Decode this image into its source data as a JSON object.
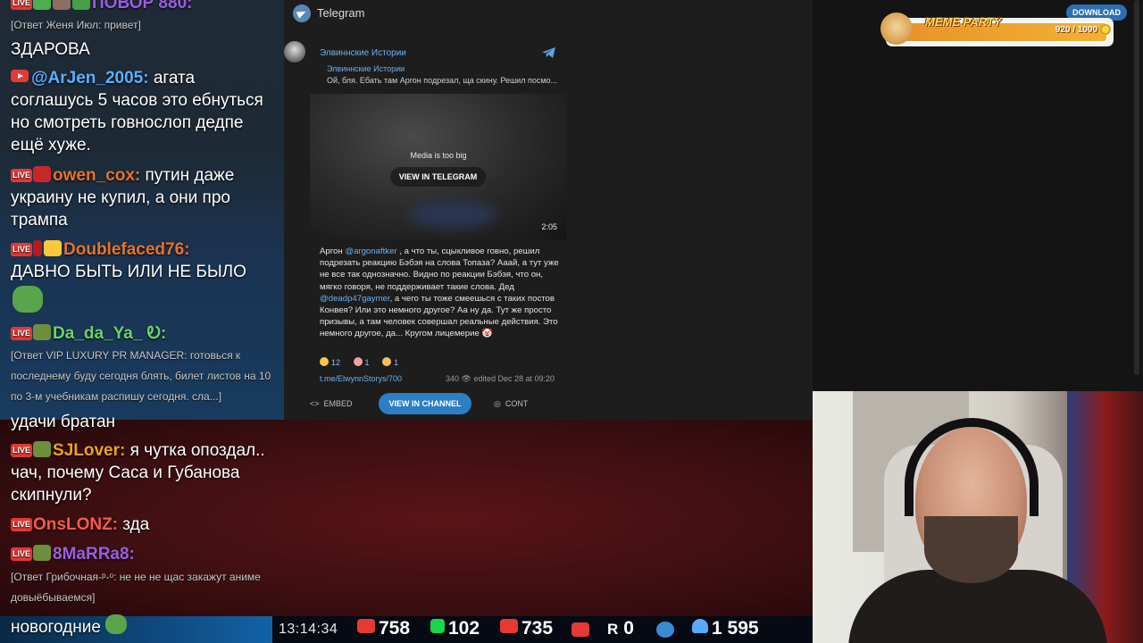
{
  "chat": {
    "top_cut_nick": "ПОВОР 880:",
    "reply1": "[Ответ Женя Июл: привет]",
    "msg_zdarova": "ЗДАРОВА",
    "msg2": {
      "nick": "@ArJen_2005:",
      "text": " агата соглашусь 5 часов это ебнуться но смотреть говнослоп дедпе ещё хуже.",
      "nick_color": "#5ab0ff"
    },
    "msg3": {
      "nick": "owen_cox:",
      "text": " путин даже украину не купил, а они про трампа",
      "nick_color": "#e7742c"
    },
    "msg4": {
      "nick": "Doublefaced76:",
      "text": "",
      "nick_color": "#e7742c"
    },
    "msg4_body": "ДАВНО БЫТЬ ИЛИ НЕ БЫЛО",
    "msg5": {
      "nick": "Da_da_Ya_ Ꭷ:",
      "text": "",
      "nick_color": "#6bd46b"
    },
    "reply2": "[Ответ VIP LUXURY PR MANAGER: готовься к последнему буду сегодня блять, билет листов на 10 по 3-м учебникам распишу сегодня. сла...]",
    "msg_udachi": "удачи братан",
    "msg6": {
      "nick": "SJLover:",
      "text": " я чутка опоздал.. чач, почему Саса и Губанова скипнули?",
      "nick_color": "#f0a21c"
    },
    "msg7": {
      "nick": "OnsLONZ:",
      "text": " зда",
      "nick_color": "#ff5a4a"
    },
    "msg8": {
      "nick": "8MaRRa8:",
      "text": "",
      "nick_color": "#9b5ee0"
    },
    "reply3": "[Ответ Грибочная-ᵖ-ᵒ: не не не щас закажут аниме довыёбываемся]",
    "input_text": "новогодние"
  },
  "telegram": {
    "app_title": "Telegram",
    "channel_name": "Элвиннские Истории",
    "forward_name": "Элвиннские Истории",
    "forward_text": "Ой, бля. Ебать там Аргон подрезал, ща скину. Решил посмо...",
    "media_text": "Media is too big",
    "media_button": "VIEW IN TELEGRAM",
    "media_duration": "2:05",
    "post_p1": "Аргон ",
    "mention1": "@argonaftker",
    "post_p2": " , а что ты, сцыкливое говно, решил подрезать реакцию Бэбэя на слова Топаза? Ааай, а тут уже не все так однозначно. Видно по реакции Бэбэя, что он, мягко говоря, не поддерживает такие слова. Дед ",
    "mention2": "@deadp47gaymer",
    "post_p3": ", а чего ты тоже смеешься с таких постов Конвея? Или это немного другое? Аа ну да. Тут же просто призывы, а там человек совершал реальные действия. Это немного другое, да... Кругом лицемерие",
    "reactions": [
      {
        "count": "12",
        "color": "#f7c84a"
      },
      {
        "count": "1",
        "color": "#f0a0a0"
      },
      {
        "count": "1",
        "color": "#f2c15a"
      }
    ],
    "post_link": "t.me/ElwynnStorys/700",
    "post_meta": "340 👁   edited  Dec 28 at 09:20",
    "embed_label": "EMBED",
    "view_channel_label": "VIEW IN CHANNEL",
    "context_label": "CONT"
  },
  "overlay": {
    "download_label": "DOWNLOAD",
    "meme_title": "MEME PARTY",
    "meme_count": "920 / 1000"
  },
  "stats": {
    "time": "13:14:34",
    "youtube": "758",
    "kick": "102",
    "live": "735",
    "rutube": "0",
    "followers": "1 595"
  }
}
